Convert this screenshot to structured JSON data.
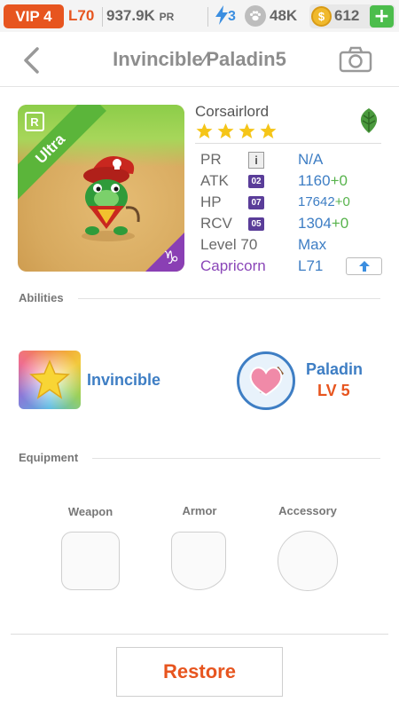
{
  "status_bar": {
    "vip": "VIP 4",
    "level": "L70",
    "pr_value": "937.9K",
    "pr_unit": "PR",
    "stamina": "3",
    "friends": "48K",
    "coins": "612",
    "add_label": "+"
  },
  "nav": {
    "title": "Invincible∕Paladin5"
  },
  "monster": {
    "name": "Corsairlord",
    "rarity_label": "Ultra",
    "rank_letter": "R",
    "star_count": 4,
    "zodiac_glyph": "♑",
    "element_icon": "leaf-icon",
    "colors": {
      "rarity_ribbon": "#5bb53a",
      "zodiac_corner": "#8a3fb4",
      "stars": "#f5c518"
    }
  },
  "stats": {
    "pr": {
      "label": "PR",
      "info_icon": "i",
      "value": "N/A"
    },
    "atk": {
      "label": "ATK",
      "badge": "02",
      "value": "1160",
      "bonus": "+0"
    },
    "hp": {
      "label": "HP",
      "badge": "07",
      "value": "17642",
      "bonus": "+0"
    },
    "rcv": {
      "label": "RCV",
      "badge": "05",
      "value": "1304",
      "bonus": "+0"
    },
    "level": {
      "label": "Level 70",
      "value": "Max"
    },
    "constellation": {
      "label": "Capricorn",
      "value": "L71"
    }
  },
  "abilities": {
    "section_label": "Abilities",
    "items": [
      {
        "name": "Invincible",
        "icon": "star-icon"
      },
      {
        "name": "Paladin",
        "level": "LV 5",
        "icon": "heart-shield-icon"
      }
    ]
  },
  "equipment": {
    "section_label": "Equipment",
    "slots": [
      {
        "label": "Weapon"
      },
      {
        "label": "Armor"
      },
      {
        "label": "Accessory"
      }
    ]
  },
  "actions": {
    "restore_label": "Restore"
  },
  "theme": {
    "accent_orange": "#e7551f",
    "accent_blue": "#3e7ec4",
    "bonus_green": "#57b34c",
    "constellation_purple": "#8a46b8"
  }
}
